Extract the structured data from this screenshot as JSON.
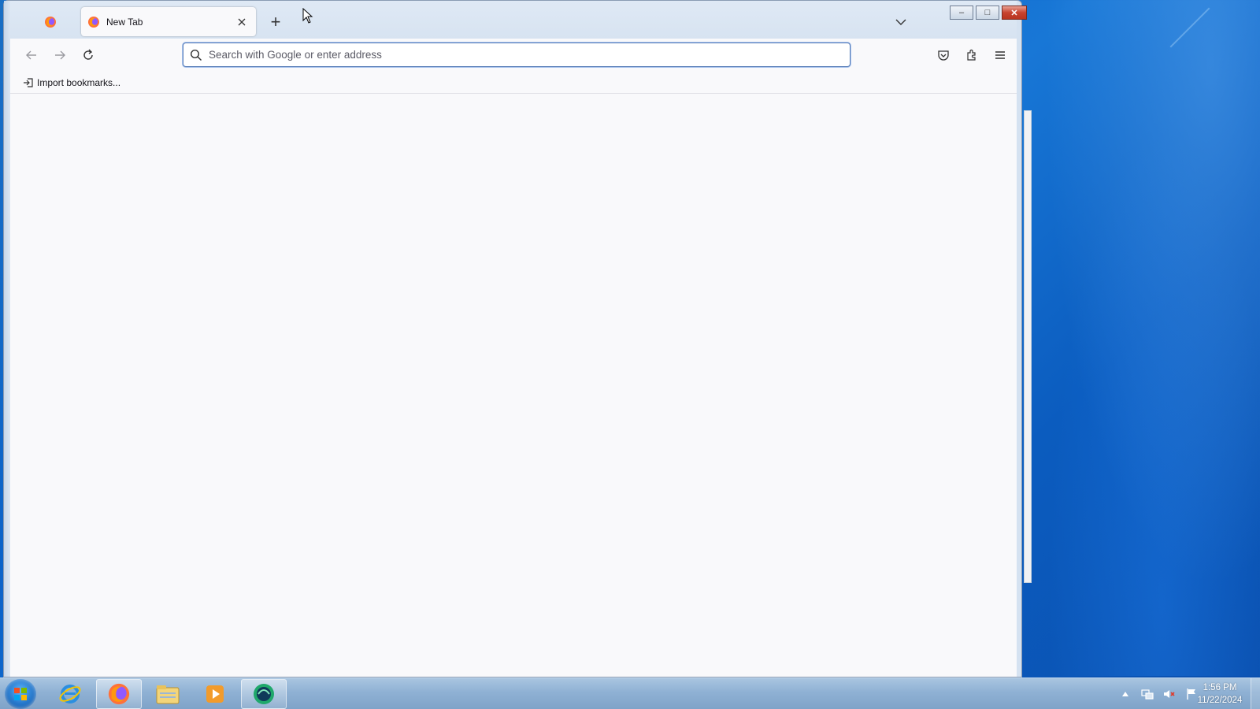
{
  "browser": {
    "tabs": [
      {
        "title": "New Tab",
        "close_icon": "close-icon"
      }
    ],
    "pinned_tab_icon": "firefox-icon",
    "new_tab_label": "+",
    "urlbar": {
      "placeholder": "Search with Google or enter address",
      "value": ""
    },
    "bookmarks_toolbar": {
      "import_label": "Import bookmarks..."
    },
    "window_controls": {
      "minimize": "–",
      "maximize": "□",
      "close": "✕"
    }
  },
  "taskbar": {
    "items": [
      {
        "name": "internet-explorer"
      },
      {
        "name": "firefox",
        "active": true
      },
      {
        "name": "file-explorer"
      },
      {
        "name": "media-player"
      },
      {
        "name": "app-green-circle",
        "active": true
      }
    ],
    "clock": {
      "time": "1:56 PM",
      "date": "11/22/2024"
    }
  },
  "colors": {
    "accent": "#5b7fb8",
    "desktop": "#0c63c9",
    "close_red": "#c7432f"
  }
}
